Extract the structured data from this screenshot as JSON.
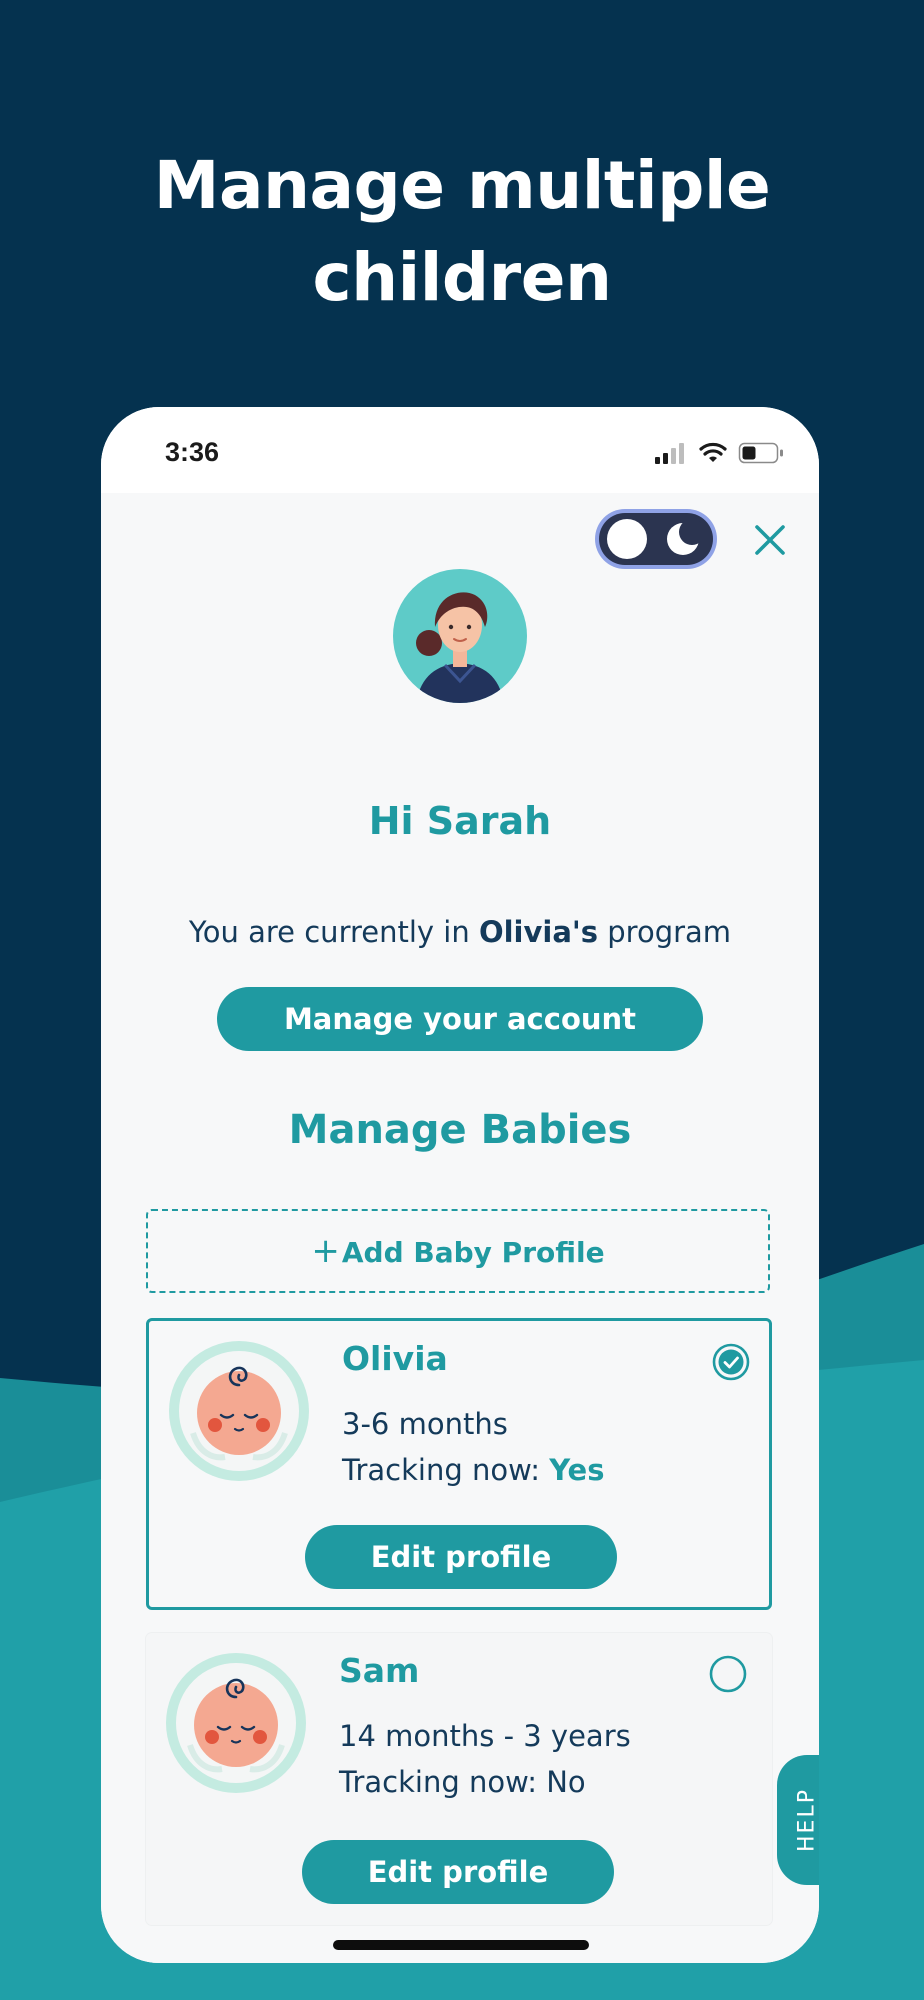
{
  "headline": {
    "line1": "Manage multiple",
    "line2": "children"
  },
  "status_bar": {
    "time": "3:36",
    "icons": [
      "signal-icon",
      "wifi-icon",
      "battery-icon"
    ]
  },
  "header": {
    "theme_toggle_icons": [
      "sun-icon",
      "moon-icon"
    ],
    "close_icon": "close-icon"
  },
  "profile": {
    "greeting": "Hi Sarah",
    "program_prefix": "You are currently in ",
    "program_child": "Olivia's",
    "program_suffix": " program",
    "manage_account_label": "Manage your account"
  },
  "babies": {
    "section_title": "Manage Babies",
    "add_plus": "+",
    "add_label": "Add Baby Profile",
    "items": [
      {
        "name": "Olivia",
        "age_range": "3-6 months",
        "tracking_label": "Tracking now: ",
        "tracking_value": "Yes",
        "selected": true,
        "edit_label": "Edit profile"
      },
      {
        "name": "Sam",
        "age_range": "14 months - 3 years",
        "tracking_label": "Tracking now: ",
        "tracking_value": "No",
        "selected": false,
        "edit_label": "Edit profile"
      }
    ]
  },
  "help_label": "HELP",
  "colors": {
    "background": "#05324f",
    "accent": "#1f9aa1",
    "text_dark": "#143a5a",
    "wave": "#1f9aa1"
  }
}
